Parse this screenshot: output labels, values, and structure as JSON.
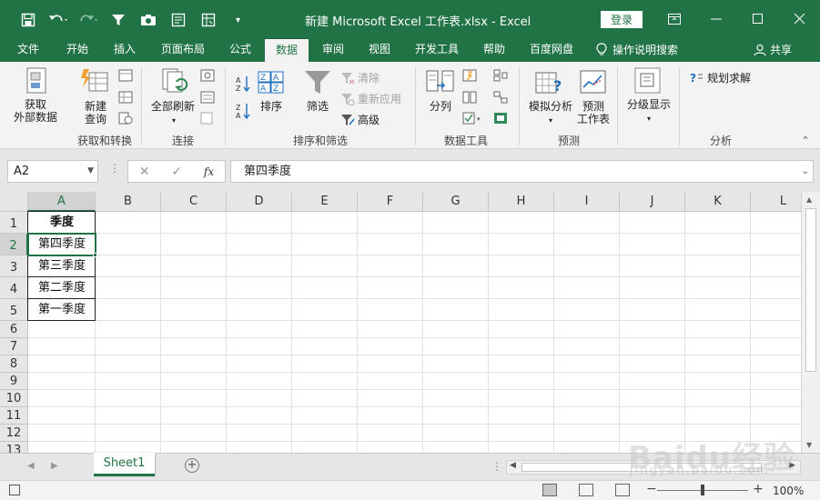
{
  "colors": {
    "accent": "#217346",
    "ribbon_bg": "#f3f3f3",
    "grid_line": "#e1e1e1"
  },
  "window": {
    "title": "新建 Microsoft Excel 工作表.xlsx  -  Excel",
    "login_label": "登录",
    "qat_icons": [
      "save-icon",
      "undo-icon",
      "redo-icon",
      "filter-icon",
      "camera-icon",
      "form-icon",
      "pivot-icon",
      "customize-qat-icon"
    ],
    "win_icons": [
      "ribbon-display-icon",
      "minimize-icon",
      "maximize-icon",
      "close-icon"
    ]
  },
  "tabs": [
    "文件",
    "开始",
    "插入",
    "页面布局",
    "公式",
    "数据",
    "审阅",
    "视图",
    "开发工具",
    "帮助",
    "百度网盘"
  ],
  "active_tab": "数据",
  "tell_me": "操作说明搜索",
  "share": "共享",
  "ribbon": {
    "get_external": "获取\n外部数据",
    "new_query": "新建\n查询",
    "refresh_all": "全部刷新",
    "sort": "排序",
    "filter": "筛选",
    "clear": "清除",
    "reapply": "重新应用",
    "advanced": "高级",
    "text_to_columns": "分列",
    "what_if": "模拟分析",
    "forecast_sheet": "预测\n工作表",
    "outline": "分级显示",
    "solver": "规划求解",
    "groups": {
      "get_transform": "获取和转换",
      "connections": "连接",
      "sort_filter": "排序和筛选",
      "data_tools": "数据工具",
      "forecast": "预测",
      "analysis": "分析"
    }
  },
  "formula_bar": {
    "name_box": "A2",
    "content": "第四季度",
    "fx": "fx"
  },
  "sheet": {
    "columns": [
      "A",
      "B",
      "C",
      "D",
      "E",
      "F",
      "G",
      "H",
      "I",
      "J",
      "K",
      "L"
    ],
    "rows": [
      "1",
      "2",
      "3",
      "4",
      "5",
      "6",
      "7",
      "8",
      "9",
      "10",
      "11",
      "12",
      "13"
    ],
    "selected_cell": "A2",
    "cells": {
      "A1": "季度",
      "A2": "第四季度",
      "A3": "第三季度",
      "A4": "第二季度",
      "A5": "第一季度"
    }
  },
  "sheet_tabs": [
    "Sheet1"
  ],
  "status": {
    "zoom": "100%"
  },
  "watermark": {
    "brand": "Baidu经验",
    "url": "jingyan.baidu.com"
  }
}
